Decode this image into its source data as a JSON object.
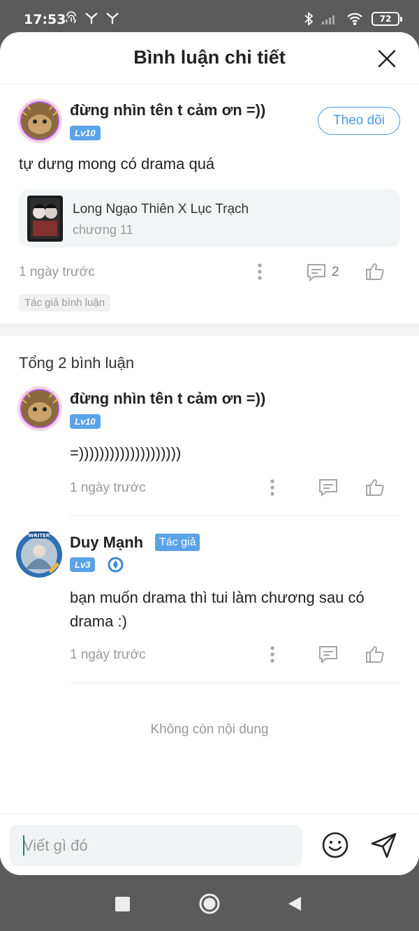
{
  "status_bar": {
    "time": "17:53",
    "battery": "72",
    "left_icons": [
      "fingerprint-icon",
      "antenna-icon",
      "antenna-icon"
    ],
    "right_icons": [
      "bluetooth-icon",
      "signal-icon",
      "wifi-icon",
      "battery-icon"
    ]
  },
  "header": {
    "title": "Bình luận chi tiết",
    "close_icon": "close-icon"
  },
  "main_comment": {
    "username": "đừng nhìn tên t cảm ơn =))",
    "level": "Lv10",
    "follow_label": "Theo dõi",
    "text": "tự dưng mong có drama quá",
    "story": {
      "title": "Long Ngạo Thiên X Lục Trạch",
      "chapter": "chương 11"
    },
    "time": "1 ngày trước",
    "reply_count": "2",
    "tag": "Tác giả bình luận"
  },
  "replies_section": {
    "total_label": "Tổng 2 bình luận",
    "replies": [
      {
        "username": "đừng nhìn tên t cảm ơn =))",
        "level": "Lv10",
        "text": "=))))))))))))))))))))",
        "time": "1 ngày trước"
      },
      {
        "username": "Duy Mạnh",
        "author_tag": "Tác giả",
        "level": "Lv3",
        "text": "bạn muốn drama thì tui làm chương sau có drama :)",
        "time": "1 ngày trước"
      }
    ],
    "end_text": "Không còn nội dung"
  },
  "composer": {
    "placeholder": "Viết gì đó",
    "emoji_icon": "emoji-icon",
    "send_icon": "send-icon"
  },
  "nav_bar": {
    "buttons": [
      "recents-square-icon",
      "home-circle-icon",
      "back-triangle-icon"
    ]
  },
  "colors": {
    "accent": "#4a9ae6",
    "badge": "#5aa3e8",
    "muted": "#999999"
  }
}
